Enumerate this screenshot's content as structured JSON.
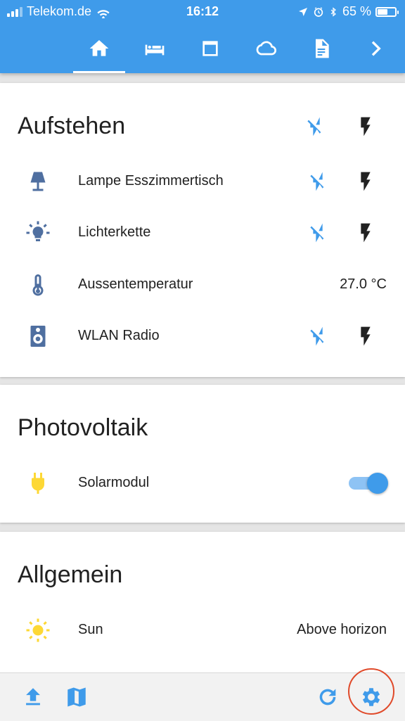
{
  "status_bar": {
    "carrier": "Telekom.de",
    "time": "16:12",
    "battery": "65 %",
    "battery_level": 0.65
  },
  "tabs": [
    {
      "icon": "home-icon",
      "active": true
    },
    {
      "icon": "bed-icon",
      "active": false
    },
    {
      "icon": "window-icon",
      "active": false
    },
    {
      "icon": "cloud-icon",
      "active": false
    },
    {
      "icon": "document-icon",
      "active": false
    },
    {
      "icon": "chevron-right-icon",
      "active": false
    }
  ],
  "cards": {
    "aufstehen": {
      "title": "Aufstehen",
      "rows": [
        {
          "label": "Lampe Esszimmertisch",
          "icon": "lamp-icon"
        },
        {
          "label": "Lichterkette",
          "icon": "lightbulb-icon"
        },
        {
          "label": "Aussentemperatur",
          "icon": "thermometer-icon",
          "value": "27.0 °C"
        },
        {
          "label": "WLAN Radio",
          "icon": "speaker-icon"
        }
      ]
    },
    "photovoltaik": {
      "title": "Photovoltaik",
      "rows": [
        {
          "label": "Solarmodul",
          "icon": "power-plug-icon",
          "toggle_on": true
        }
      ]
    },
    "allgemein": {
      "title": "Allgemein",
      "rows": [
        {
          "label": "Sun",
          "icon": "sun-icon",
          "value": "Above horizon"
        }
      ]
    }
  },
  "bottom_bar": [
    "upload-icon",
    "map-icon",
    "refresh-icon",
    "settings-icon"
  ],
  "colors": {
    "primary": "#3f9bea",
    "icon_state_off": "#4f6fa0",
    "icon_state_on": "#fdd835",
    "flash_off": "#3f9bea",
    "flash_on": "#212121",
    "highlight": "#e04a2a"
  }
}
